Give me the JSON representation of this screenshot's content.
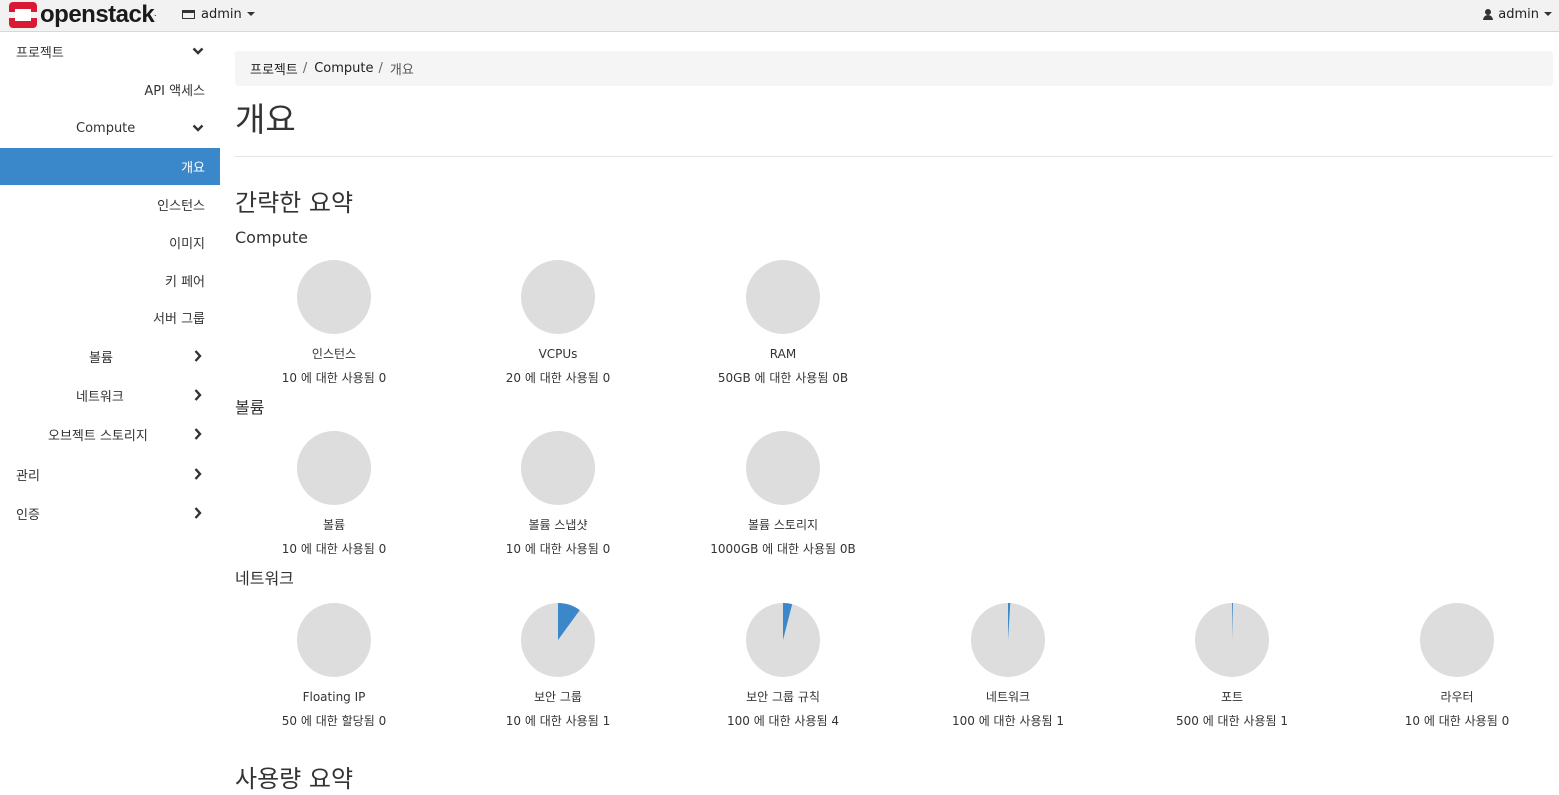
{
  "colors": {
    "accent": "#3a87c9",
    "pie_bg": "#dddddd",
    "navbar_bg": "#f2f2f2",
    "logo_red": "#da1a32"
  },
  "navbar": {
    "logo_text": "openstack",
    "logo_mark": ".",
    "project_icon": "project-icon",
    "project_label": "admin",
    "user_icon": "user-icon",
    "user_label": "admin"
  },
  "sidebar": {
    "items": [
      {
        "label": "프로젝트",
        "icon": "chevron-down-icon"
      },
      {
        "label": "API 액세스"
      },
      {
        "label": "Compute",
        "icon": "chevron-down-icon"
      },
      {
        "label": "개요",
        "active": true
      },
      {
        "label": "인스턴스"
      },
      {
        "label": "이미지"
      },
      {
        "label": "키 페어"
      },
      {
        "label": "서버 그룹"
      },
      {
        "label": "볼륨",
        "icon": "chevron-right-icon"
      },
      {
        "label": "네트워크",
        "icon": "chevron-right-icon"
      },
      {
        "label": "오브젝트 스토리지",
        "icon": "chevron-right-icon"
      },
      {
        "label": "관리",
        "icon": "chevron-right-icon"
      },
      {
        "label": "인증",
        "icon": "chevron-right-icon"
      }
    ]
  },
  "breadcrumb": {
    "items": [
      "프로젝트",
      "Compute"
    ],
    "current": "개요"
  },
  "page_title": "개요",
  "summary_title": "간략한 요약",
  "next_section_title": "사용량 요약",
  "groups": [
    {
      "title": "Compute",
      "charts": [
        {
          "label": "인스턴스",
          "usage": "10 에 대한 사용됨 0",
          "fraction": 0
        },
        {
          "label": "VCPUs",
          "usage": "20 에 대한 사용됨 0",
          "fraction": 0
        },
        {
          "label": "RAM",
          "usage": "50GB 에 대한 사용됨 0B",
          "fraction": 0
        }
      ]
    },
    {
      "title": "볼륨",
      "charts": [
        {
          "label": "볼륨",
          "usage": "10 에 대한 사용됨 0",
          "fraction": 0
        },
        {
          "label": "볼륨 스냅샷",
          "usage": "10 에 대한 사용됨 0",
          "fraction": 0
        },
        {
          "label": "볼륨 스토리지",
          "usage": "1000GB 에 대한 사용됨 0B",
          "fraction": 0
        }
      ]
    },
    {
      "title": "네트워크",
      "charts": [
        {
          "label": "Floating IP",
          "usage": "50 에 대한 할당됨 0",
          "fraction": 0
        },
        {
          "label": "보안 그룹",
          "usage": "10 에 대한 사용됨 1",
          "fraction": 0.1
        },
        {
          "label": "보안 그룹 규칙",
          "usage": "100 에 대한 사용됨 4",
          "fraction": 0.04
        },
        {
          "label": "네트워크",
          "usage": "100 에 대한 사용됨 1",
          "fraction": 0.01
        },
        {
          "label": "포트",
          "usage": "500 에 대한 사용됨 1",
          "fraction": 0.002
        },
        {
          "label": "라우터",
          "usage": "10 에 대한 사용됨 0",
          "fraction": 0
        }
      ]
    }
  ]
}
